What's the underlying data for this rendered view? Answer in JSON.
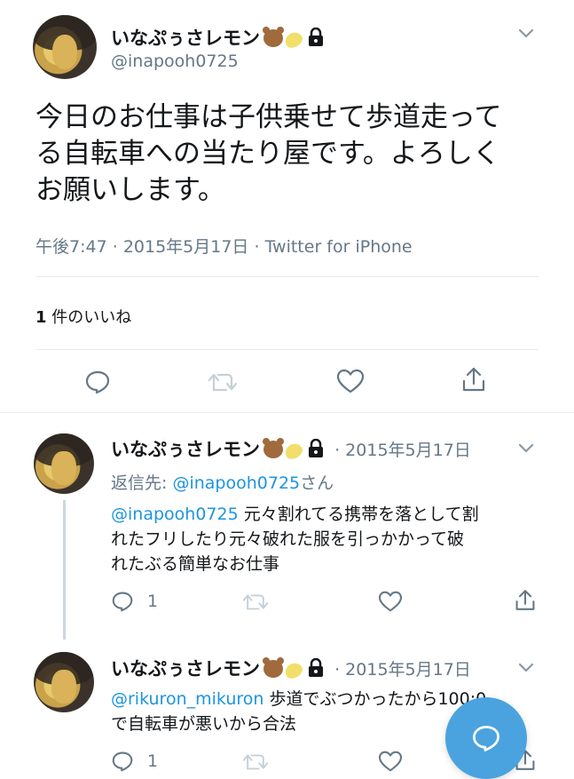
{
  "main_tweet": {
    "name": "いなぷぅさレモン",
    "handle": "@inapooh0725",
    "text_lines": [
      "今日のお仕事は子供乗せて歩道走って",
      "る自転車への当たり屋です。よろしく",
      "お願いします。"
    ],
    "time": "午後7:47",
    "sep1": "·",
    "date": "2015年5月17日",
    "sep2": "·",
    "client": "Twitter for iPhone",
    "likes_count": "1",
    "likes_label": "件のいいね"
  },
  "replies": [
    {
      "name": "いなぷぅさレモン",
      "date": "· 2015年5月17日",
      "reply_to_label": "返信先:",
      "reply_to_handle": "@inapooh0725",
      "reply_to_suffix": "さん",
      "mention": "@inapooh0725",
      "text_first": " 元々割れてる携帯を落として割",
      "text_lines": [
        "れたフリしたり元々破れた服を引っかかって破",
        "れたぶる簡単なお仕事"
      ],
      "reply_count": "1"
    },
    {
      "name": "いなぷぅさレモン",
      "date": "· 2015年5月17日",
      "mention": "@rikuron_mikuron",
      "text_first": " 歩道でぶつかったから100:0",
      "text_lines": [
        "で自転車が悪いから合法"
      ],
      "reply_count": "1"
    }
  ],
  "icons": [
    "chevron-down-icon",
    "reply-icon",
    "retweet-icon",
    "like-icon",
    "share-icon",
    "lock-icon",
    "bear-emoji-icon",
    "lemon-emoji-icon",
    "compose-icon"
  ],
  "colors": {
    "link": "#1b95e0",
    "secondary": "#657786",
    "divider": "#e6ecf0",
    "fab": "#4aa3df"
  }
}
